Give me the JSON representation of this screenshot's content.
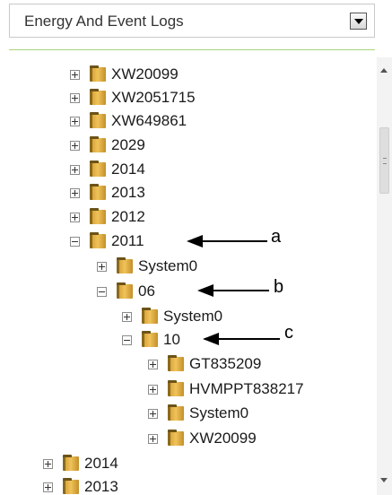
{
  "dropdown": {
    "selected": "Energy And Event Logs"
  },
  "tree": [
    {
      "label": "XW20099",
      "expanded": false
    },
    {
      "label": "XW2051715",
      "expanded": false
    },
    {
      "label": "XW649861",
      "expanded": false
    },
    {
      "label": "2029",
      "expanded": false
    },
    {
      "label": "2014",
      "expanded": false
    },
    {
      "label": "2013",
      "expanded": false
    },
    {
      "label": "2012",
      "expanded": false
    },
    {
      "label": "2011",
      "expanded": true
    },
    {
      "label": "System0",
      "expanded": false
    },
    {
      "label": "06",
      "expanded": true
    },
    {
      "label": "System0",
      "expanded": false
    },
    {
      "label": "10",
      "expanded": true
    },
    {
      "label": "GT835209",
      "expanded": false
    },
    {
      "label": "HVMPPT838217",
      "expanded": false
    },
    {
      "label": "System0",
      "expanded": false
    },
    {
      "label": "XW20099",
      "expanded": false
    },
    {
      "label": "2014",
      "expanded": false
    },
    {
      "label": "2013",
      "expanded": false
    }
  ],
  "annotations": [
    {
      "letter": "a"
    },
    {
      "letter": "b"
    },
    {
      "letter": "c"
    }
  ],
  "icons": {
    "expander_open": "minus-box-icon",
    "expander_closed": "plus-box-icon",
    "node": "folder-icon"
  }
}
